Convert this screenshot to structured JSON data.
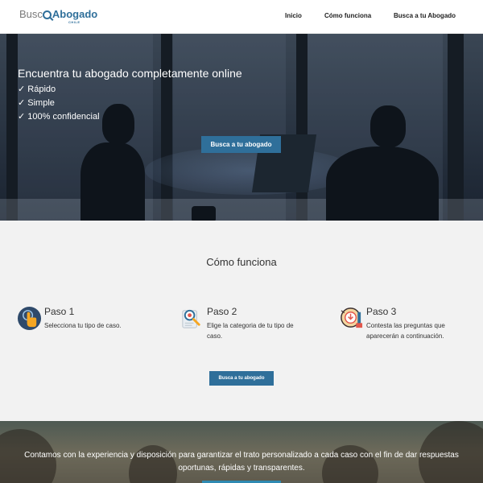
{
  "header": {
    "logo": {
      "part1": "Busc",
      "part2": "Abogado",
      "sub": "CHILE"
    },
    "nav": [
      {
        "label": "Inicio"
      },
      {
        "label": "Cómo funciona"
      },
      {
        "label": "Busca a tu Abogado"
      }
    ]
  },
  "hero": {
    "title": "Encuentra tu abogado completamente online",
    "checks": [
      "✓ Rápido",
      "✓ Simple",
      "✓ 100% confidencial"
    ],
    "button": "Busca a tu abogado"
  },
  "how": {
    "title": "Cómo funciona",
    "steps": [
      {
        "title": "Paso 1",
        "text": "Selecciona tu tipo de caso.",
        "icon": "hand-pointer-icon"
      },
      {
        "title": "Paso 2",
        "text": "Elige la categoria de tu tipo de caso.",
        "icon": "document-search-icon"
      },
      {
        "title": "Paso 3",
        "text": "Contesta las preguntas que aparecerán a continuación.",
        "icon": "idea-head-icon"
      }
    ],
    "button": "Busca a tu abogado"
  },
  "bottom": {
    "text": "Contamos con la experiencia y disposición para garantizar el trato personalizado a cada caso con el fin de dar respuestas oportunas, rápidas y transparentes."
  },
  "colors": {
    "accent": "#2f6f9a",
    "section_bg": "#f2f2f2"
  }
}
